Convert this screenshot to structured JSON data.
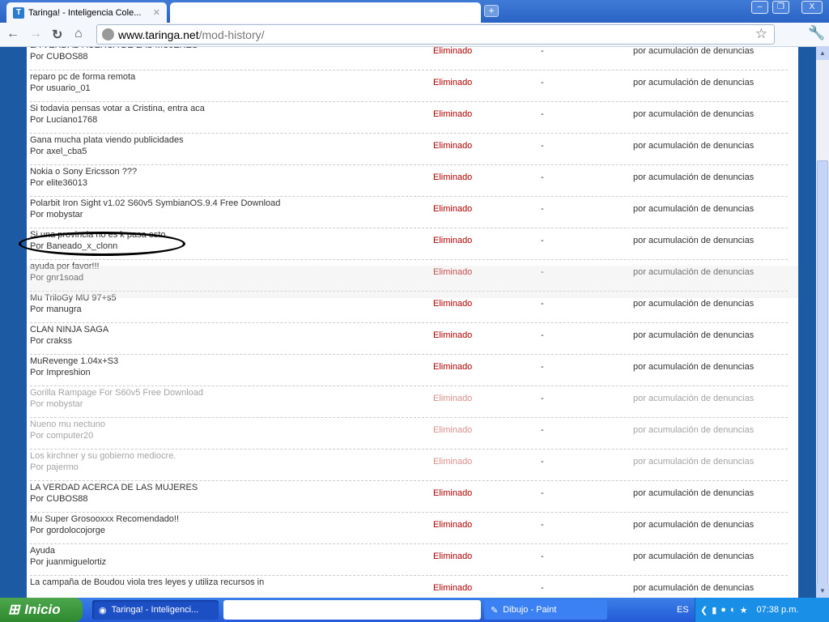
{
  "browser": {
    "tab_title": "Taringa! - Inteligencia Cole...",
    "tab_favicon": "T",
    "url_host": "www.taringa.net",
    "url_path": "/mod-history/"
  },
  "rows": [
    {
      "title": "LA VERDAD ACERCA DE LAS MUJERES",
      "author": "CUBOS88",
      "status": "Eliminado",
      "mod": "-",
      "reason": "por acumulación de denuncias"
    },
    {
      "title": "reparo pc de forma remota",
      "author": "usuario_01",
      "status": "Eliminado",
      "mod": "-",
      "reason": "por acumulación de denuncias"
    },
    {
      "title": "Si todavia pensas votar a Cristina, entra aca",
      "author": "Luciano1768",
      "status": "Eliminado",
      "mod": "-",
      "reason": "por acumulación de denuncias"
    },
    {
      "title": "Gana mucha plata viendo publicidades",
      "author": "axel_cba5",
      "status": "Eliminado",
      "mod": "-",
      "reason": "por acumulación de denuncias"
    },
    {
      "title": "Nokia o Sony Ericsson ???",
      "author": "elite36013",
      "status": "Eliminado",
      "mod": "-",
      "reason": "por acumulación de denuncias"
    },
    {
      "title": "Polarbit Iron Sight v1.02 S60v5 SymbianOS.9.4 Free Download",
      "author": "mobystar",
      "status": "Eliminado",
      "mod": "-",
      "reason": "por acumulación de denuncias"
    },
    {
      "title": "Si una provincia no es k pasa esto",
      "author": "Baneado_x_clonn",
      "status": "Eliminado",
      "mod": "-",
      "reason": "por acumulación de denuncias"
    },
    {
      "title": "ayuda por favor!!!",
      "author": "gnr1soad",
      "status": "Eliminado",
      "mod": "-",
      "reason": "por acumulación de denuncias"
    },
    {
      "title": "Mu TriloGy MU 97+s5",
      "author": "manugra",
      "status": "Eliminado",
      "mod": "-",
      "reason": "por acumulación de denuncias"
    },
    {
      "title": "CLAN NINJA SAGA",
      "author": "crakss",
      "status": "Eliminado",
      "mod": "-",
      "reason": "por acumulación de denuncias"
    },
    {
      "title": "MuRevenge 1.04x+S3",
      "author": "Impreshion",
      "status": "Eliminado",
      "mod": "-",
      "reason": "por acumulación de denuncias"
    },
    {
      "title": "Gorilla Rampage For S60v5 Free Download",
      "author": "mobystar",
      "status": "Eliminado",
      "mod": "-",
      "reason": "por acumulación de denuncias"
    },
    {
      "title": "Nueno mu nectuno",
      "author": "computer20",
      "status": "Eliminado",
      "mod": "-",
      "reason": "por acumulación de denuncias"
    },
    {
      "title": "Los kirchner y su gobierno mediocre.",
      "author": "pajermo",
      "status": "Eliminado",
      "mod": "-",
      "reason": "por acumulación de denuncias"
    },
    {
      "title": "LA VERDAD ACERCA DE LAS MUJERES",
      "author": "CUBOS88",
      "status": "Eliminado",
      "mod": "-",
      "reason": "por acumulación de denuncias"
    },
    {
      "title": "Mu Super Grosooxxx Recomendado!!",
      "author": "gordolocojorge",
      "status": "Eliminado",
      "mod": "-",
      "reason": "por acumulación de denuncias"
    },
    {
      "title": "Ayuda",
      "author": "juanmiguelortiz",
      "status": "Eliminado",
      "mod": "-",
      "reason": "por acumulación de denuncias"
    },
    {
      "title": "La campaña de Boudou viola tres leyes y utiliza recursos in",
      "author": "",
      "status": "Eliminado",
      "mod": "-",
      "reason": "por acumulación de denuncias"
    }
  ],
  "by_prefix": "Por",
  "taskbar": {
    "start": "Inicio",
    "task1": "Taringa! - Inteligenci...",
    "task2": "Dibujo - Paint",
    "lang": "ES",
    "clock": "07:38 p.m."
  }
}
